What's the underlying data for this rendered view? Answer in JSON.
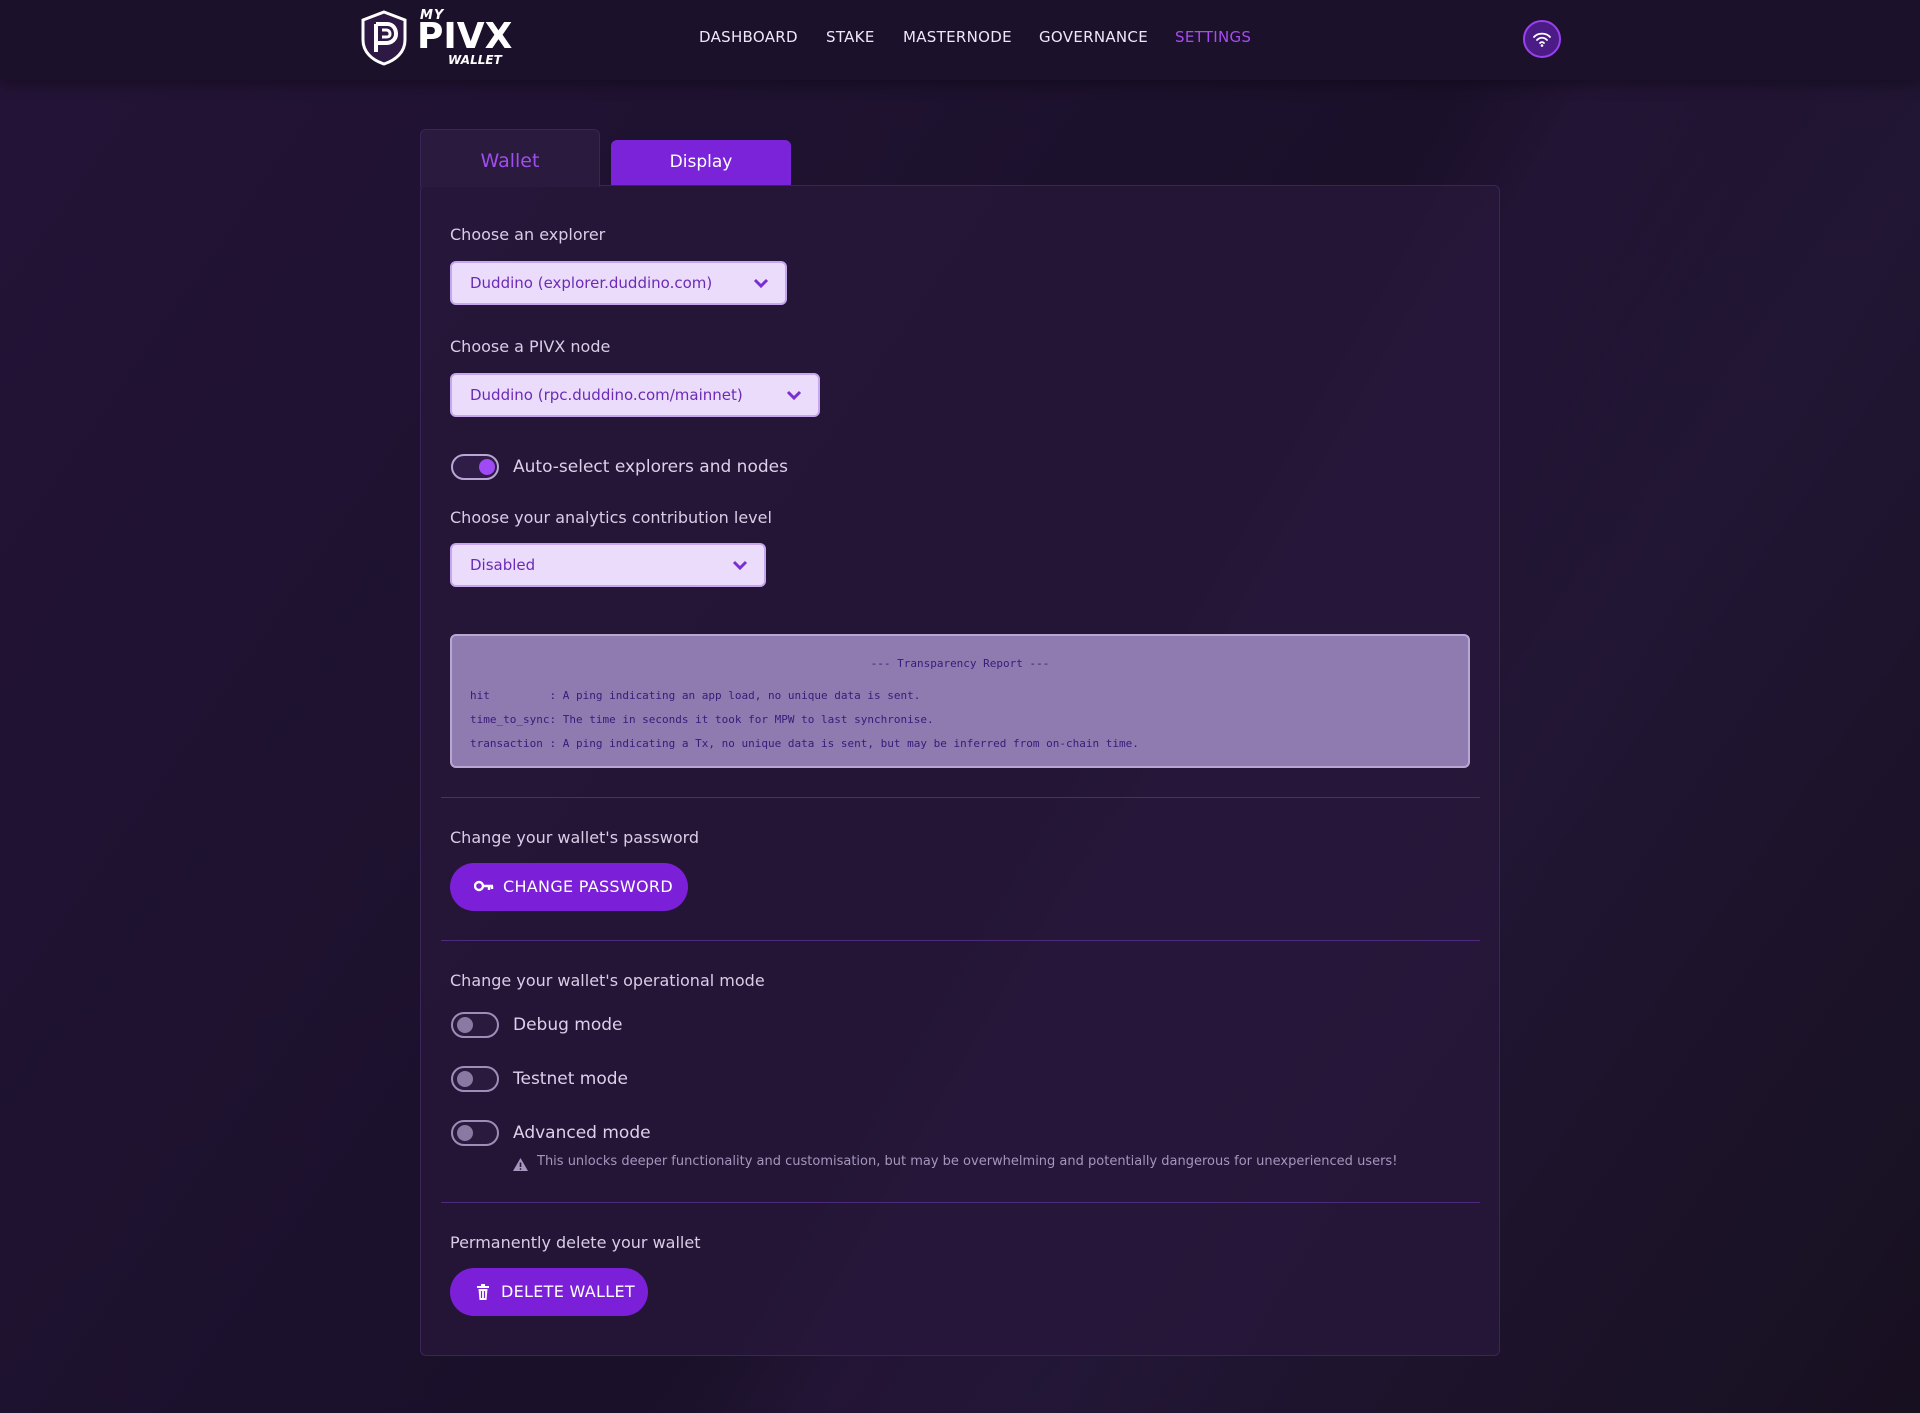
{
  "header": {
    "logo": {
      "my": "MY",
      "brand": "PIVX",
      "wallet": "WALLET"
    },
    "nav": [
      {
        "label": "DASHBOARD",
        "active": false
      },
      {
        "label": "STAKE",
        "active": false
      },
      {
        "label": "MASTERNODE",
        "active": false
      },
      {
        "label": "GOVERNANCE",
        "active": false
      },
      {
        "label": "SETTINGS",
        "active": true
      }
    ],
    "network_icon": "wifi-icon"
  },
  "tabs": [
    {
      "label": "Wallet",
      "selected": true
    },
    {
      "label": "Display",
      "selected": false
    }
  ],
  "settings": {
    "explorer": {
      "label": "Choose an explorer",
      "value": "Duddino (explorer.duddino.com)"
    },
    "node": {
      "label": "Choose a PIVX node",
      "value": "Duddino (rpc.duddino.com/mainnet)"
    },
    "auto_select": {
      "label": "Auto-select explorers and nodes",
      "on": true
    },
    "analytics": {
      "label": "Choose your analytics contribution level",
      "value": "Disabled"
    },
    "transparency": {
      "title": "--- Transparency Report ---",
      "lines": [
        "hit         : A ping indicating an app load, no unique data is sent.",
        "time_to_sync: The time in seconds it took for MPW to last synchronise.",
        "transaction : A ping indicating a Tx, no unique data is sent, but may be inferred from on-chain time."
      ]
    },
    "password": {
      "label": "Change your wallet's password",
      "button": "CHANGE PASSWORD"
    },
    "mode": {
      "label": "Change your wallet's operational mode",
      "debug": {
        "label": "Debug mode",
        "on": false
      },
      "testnet": {
        "label": "Testnet mode",
        "on": false
      },
      "advanced": {
        "label": "Advanced mode",
        "on": false
      },
      "warning": "This unlocks deeper functionality and customisation, but may be overwhelming and potentially dangerous for unexperienced users!"
    },
    "delete": {
      "label": "Permanently delete your wallet",
      "button": "DELETE WALLET"
    }
  },
  "colors": {
    "accent": "#7b20d8",
    "active_nav": "#a64cf0",
    "select_bg": "#ebdcfb",
    "report_bg": "#8f7bb0"
  }
}
